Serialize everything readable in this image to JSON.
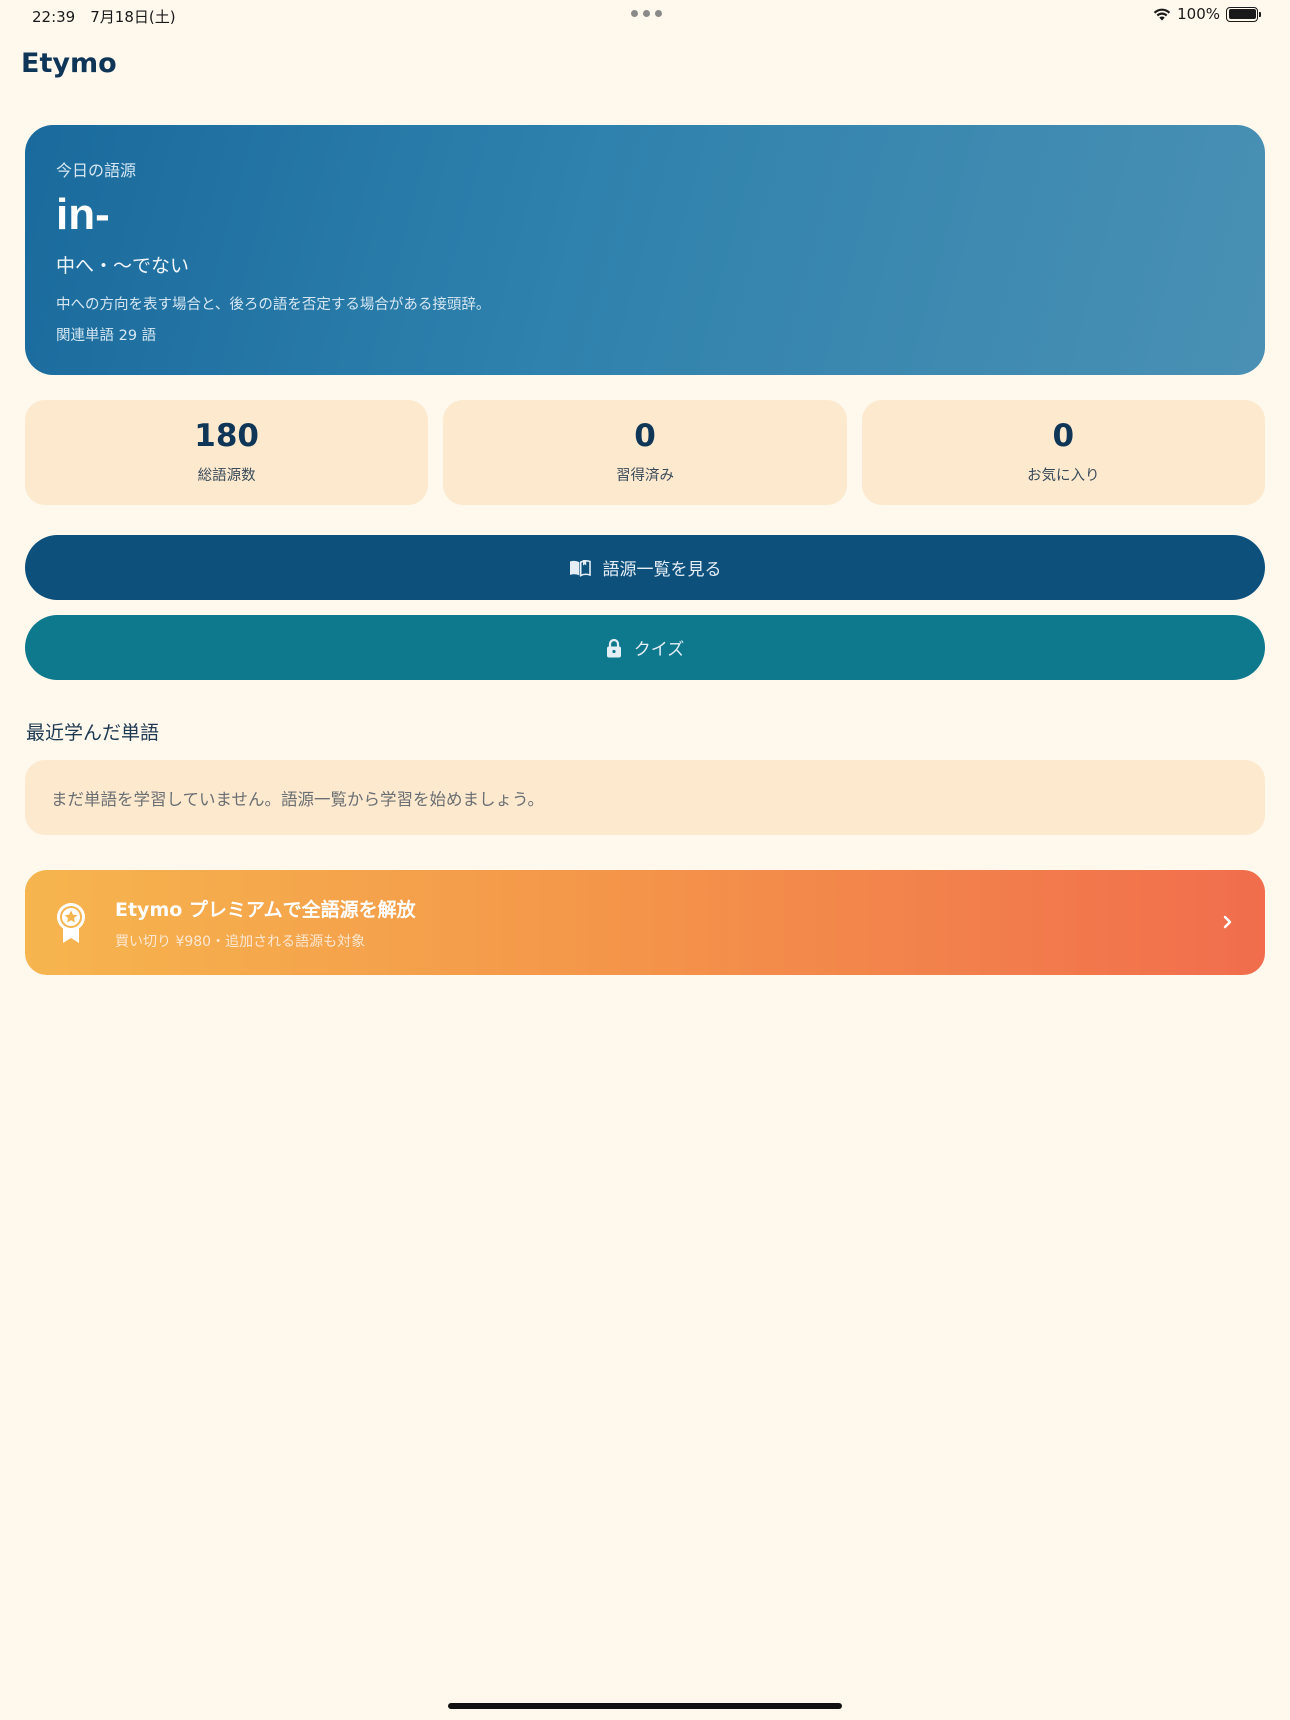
{
  "status_bar": {
    "time": "22:39　7月18日(土)",
    "battery": "100%"
  },
  "app": {
    "title": "Etymo"
  },
  "hero": {
    "label": "今日の語源",
    "root": "in-",
    "meaning": "中へ・〜でない",
    "description": "中への方向を表す場合と、後ろの語を否定する場合がある接頭辞。",
    "related_count": "関連単語 29 語"
  },
  "stats": [
    {
      "value": "180",
      "label": "総語源数"
    },
    {
      "value": "0",
      "label": "習得済み"
    },
    {
      "value": "0",
      "label": "お気に入り"
    }
  ],
  "buttons": {
    "browse": "語源一覧を見る",
    "quiz": "クイズ"
  },
  "recent": {
    "title": "最近学んだ単語",
    "empty": "まだ単語を学習していません。語源一覧から学習を始めましょう。"
  },
  "premium": {
    "title": "Etymo プレミアムで全語源を解放",
    "subtitle": "買い切り ¥980・追加される語源も対象"
  },
  "icons": {
    "browse": "book-open-icon",
    "quiz": "lock-icon",
    "premium": "award-badge-icon",
    "chevron": "chevron-right-icon"
  },
  "colors": {
    "background": "#fef8ed",
    "primary": "#0e507c",
    "teal": "#0e788c",
    "card": "#fce9ce"
  }
}
